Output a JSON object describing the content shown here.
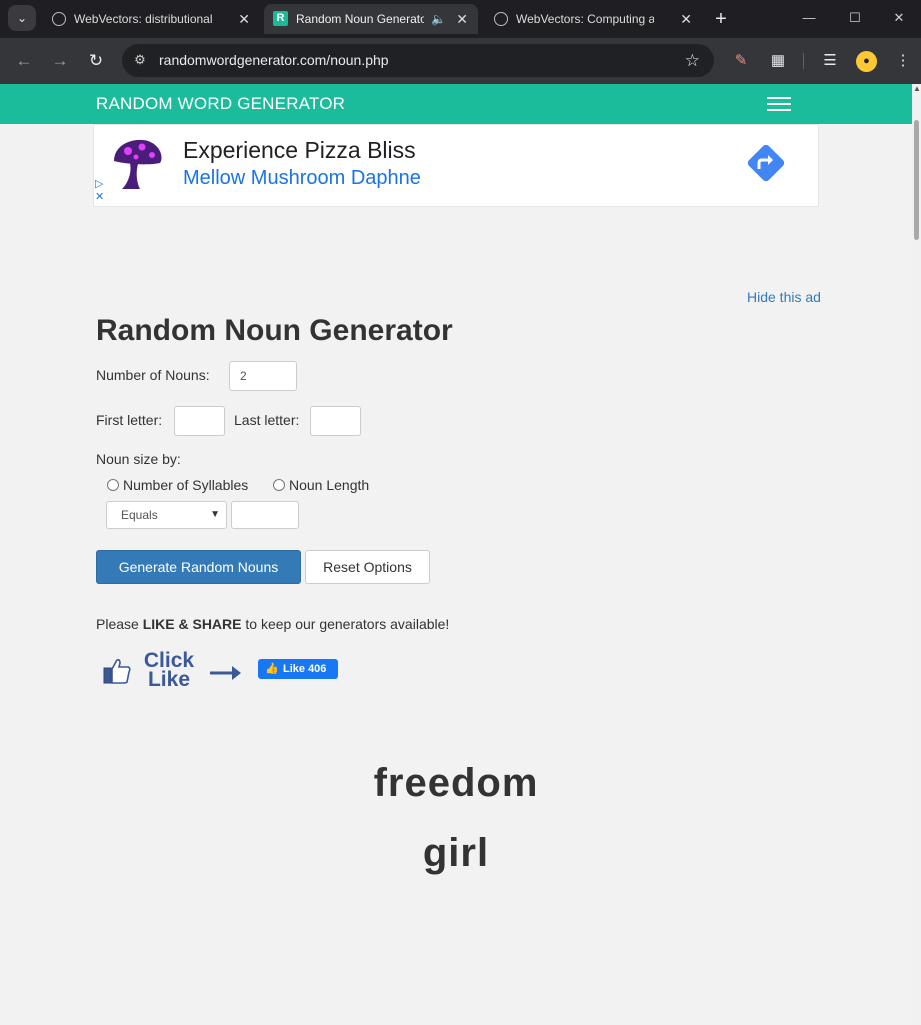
{
  "browser": {
    "tabs": [
      {
        "title": "WebVectors: distributional se",
        "active": false
      },
      {
        "title": "Random Noun Generato",
        "active": true
      },
      {
        "title": "WebVectors: Computing ass",
        "active": false
      }
    ],
    "url": "randomwordgenerator.com/noun.php"
  },
  "site": {
    "brand": "RANDOM WORD GENERATOR"
  },
  "ad": {
    "headline": "Experience Pizza Bliss",
    "subline": "Mellow Mushroom Daphne",
    "hide_label": "Hide this ad"
  },
  "form": {
    "title": "Random Noun Generator",
    "count_label": "Number of Nouns:",
    "count_value": "2",
    "first_letter_label": "First letter:",
    "last_letter_label": "Last letter:",
    "size_label": "Noun size by:",
    "option_syllables": "Number of Syllables",
    "option_length": "Noun Length",
    "comparator": "Equals",
    "generate_label": "Generate Random Nouns",
    "reset_label": "Reset Options"
  },
  "share": {
    "prefix": "Please ",
    "emphasis": "LIKE & SHARE",
    "suffix": " to keep our generators available!",
    "click_line1": "Click",
    "click_line2": "Like",
    "fb_like": "Like 406"
  },
  "results": [
    "freedom",
    "girl"
  ],
  "colors": {
    "brand": "#1abc9c",
    "primary": "#337ab7",
    "facebook": "#1877f2"
  }
}
